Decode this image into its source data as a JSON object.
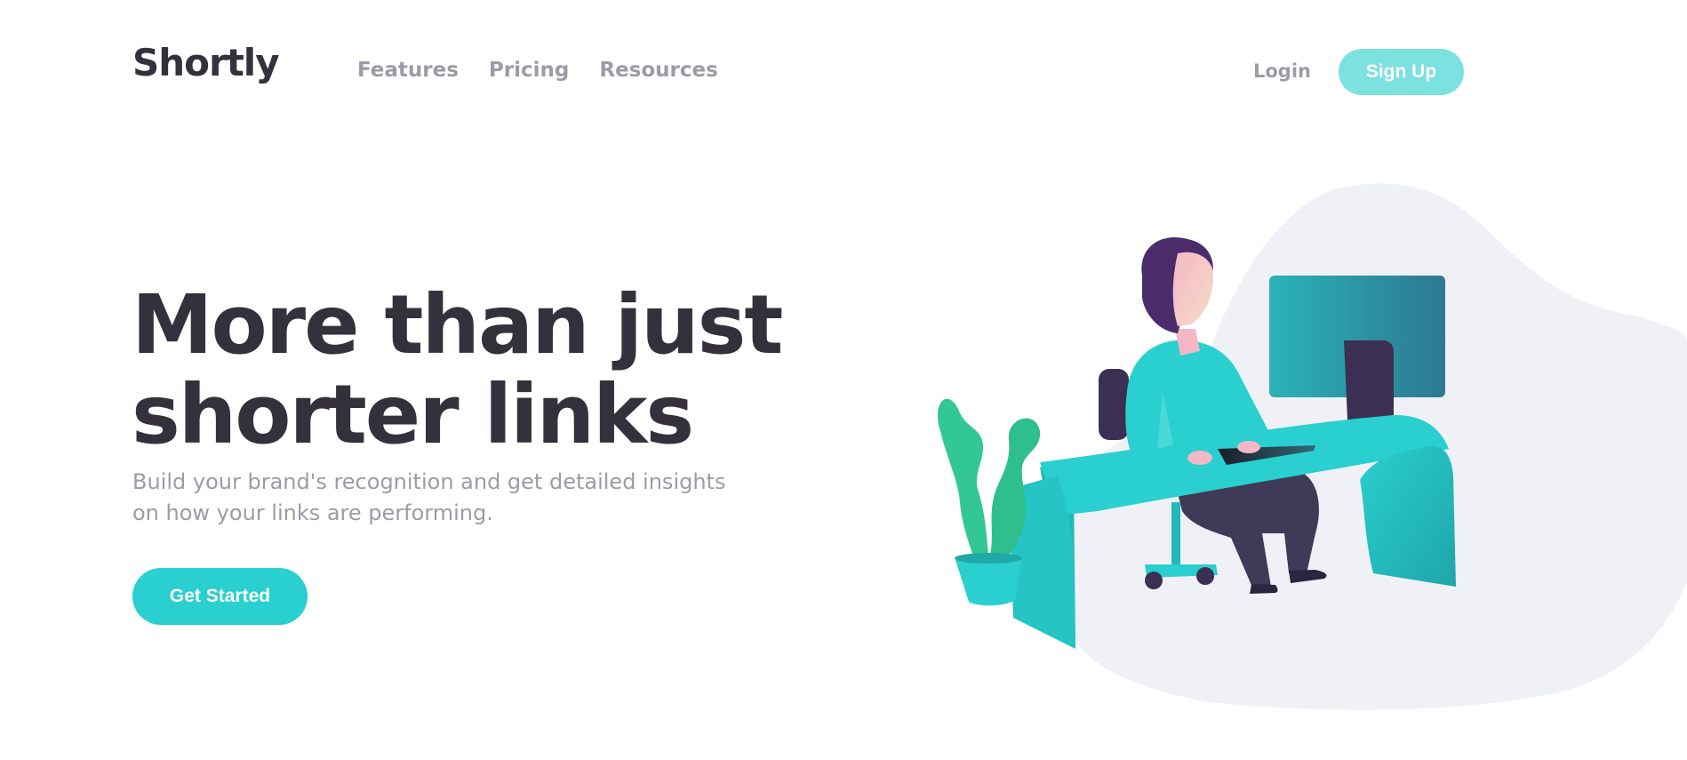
{
  "brand": {
    "logo": "Shortly"
  },
  "nav": {
    "links": [
      "Features",
      "Pricing",
      "Resources"
    ],
    "login_label": "Login",
    "signup_label": "Sign Up"
  },
  "hero": {
    "headline": "More than just shorter links",
    "subtext": "Build your brand's recognition and get detailed insights on how your links are performing.",
    "cta_label": "Get Started",
    "illustration": "person-working-at-desk-illustration"
  },
  "colors": {
    "primary_cyan": "#2acfcf",
    "light_cyan": "#7be1e1",
    "dark_violet": "#3b3054",
    "text_dark": "#34313d",
    "gray": "#9e9aa7",
    "blob_bg": "#f0f1f6",
    "plant_green": "#33c795"
  }
}
